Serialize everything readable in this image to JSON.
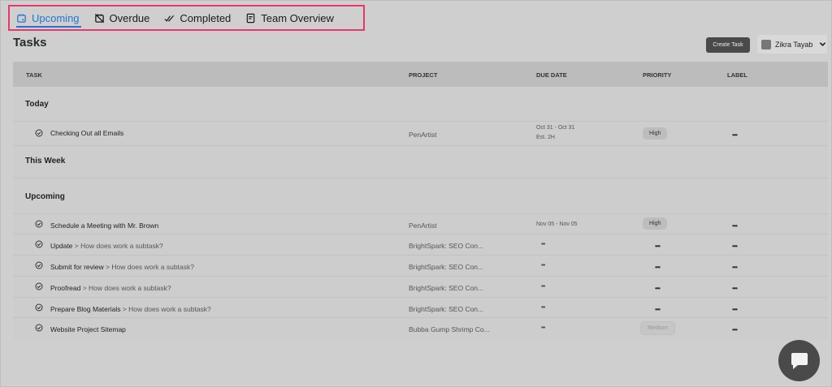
{
  "tabs": [
    {
      "label": "Upcoming",
      "icon": "calendar-icon",
      "active": true
    },
    {
      "label": "Overdue",
      "icon": "calendar-x-icon",
      "active": false
    },
    {
      "label": "Completed",
      "icon": "double-check-icon",
      "active": false
    },
    {
      "label": "Team Overview",
      "icon": "document-icon",
      "active": false
    }
  ],
  "page_title": "Tasks",
  "create_task_label": "Create Task",
  "user": {
    "name": "Zikra Tayab",
    "avatar": "avatar-icon",
    "dropdown": "chevron-down-icon"
  },
  "columns": {
    "task": "TASK",
    "project": "PROJECT",
    "due_date": "DUE DATE",
    "priority": "PRIORITY",
    "label": "LABEL"
  },
  "sections": {
    "today": "Today",
    "this_week": "This Week",
    "upcoming": "Upcoming"
  },
  "rows": [
    {
      "task": "Checking Out all Emails",
      "parent": "",
      "project": "PenArtist",
      "due": "Oct 31 - Oct 31",
      "est": "Est. 2H",
      "priority": "High",
      "label": "•••"
    },
    {
      "task": "Schedule a Meeting with Mr. Brown",
      "parent": "",
      "project": "PenArtist",
      "due": "Nov 05 - Nov 05",
      "est": "",
      "priority": "High",
      "label": "•••"
    },
    {
      "task": "Update",
      "parent": "> How does work a subtask?",
      "project": "BrightSpark: SEO Con...",
      "due": "•••",
      "est": "",
      "priority": "•••",
      "label": "•••"
    },
    {
      "task": "Submit for review",
      "parent": "> How does work a subtask?",
      "project": "BrightSpark: SEO Con...",
      "due": "•••",
      "est": "",
      "priority": "•••",
      "label": "•••"
    },
    {
      "task": "Proofread",
      "parent": "> How does work a subtask?",
      "project": "BrightSpark: SEO Con...",
      "due": "•••",
      "est": "",
      "priority": "•••",
      "label": "•••"
    },
    {
      "task": "Prepare Blog Materials",
      "parent": "> How does work a subtask?",
      "project": "BrightSpark: SEO Con...",
      "due": "•••",
      "est": "",
      "priority": "•••",
      "label": "•••"
    },
    {
      "task": "Website Project Sitemap",
      "parent": "",
      "project": "Bubba Gump Shrimp Co...",
      "due": "•••",
      "est": "",
      "priority": "Medium",
      "label": "•••"
    }
  ],
  "chat_icon": "chat-bubble-icon",
  "colors": {
    "accent": "#2474d6",
    "highlight_border": "#e8386b",
    "button": "#4a4a4a"
  }
}
